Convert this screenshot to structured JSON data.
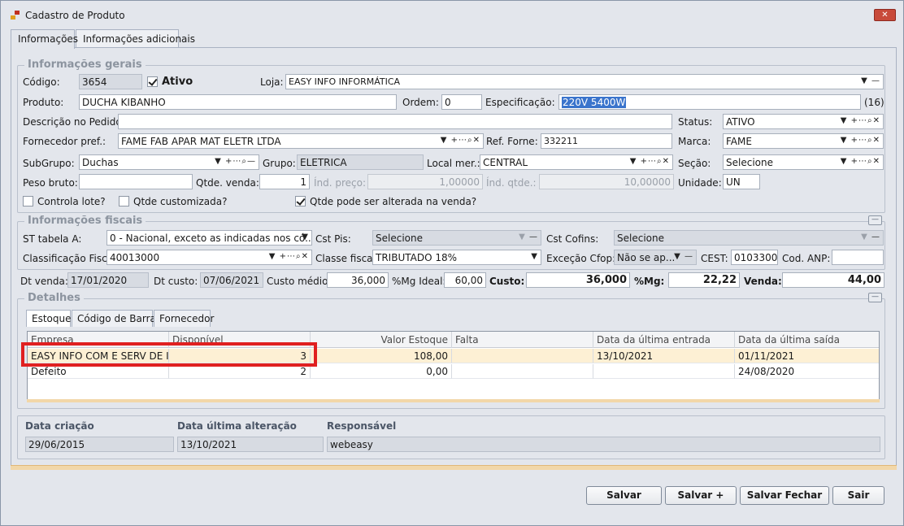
{
  "window": {
    "title": "Cadastro de Produto",
    "close": "✕"
  },
  "tabs": [
    {
      "label": "Informações"
    },
    {
      "label": "Informações adicionais"
    }
  ],
  "gerais": {
    "title": "Informações gerais",
    "codigo_label": "Código:",
    "codigo": "3654",
    "ativo_label": "Ativo",
    "ativo_checked": true,
    "loja_label": "Loja:",
    "loja": "EASY INFO INFORMÁTICA",
    "produto_label": "Produto:",
    "produto": "DUCHA KIBANHO",
    "ordem_label": "Ordem:",
    "ordem": "0",
    "especificacao_label": "Especificação:",
    "especificacao": "220V 5400W",
    "especificacao_count": "(16)",
    "descricao_label": "Descrição no Pedido:",
    "descricao": "",
    "status_label": "Status:",
    "status": "ATIVO",
    "fornecedor_label": "Fornecedor pref.:",
    "fornecedor": "FAME FAB APAR MAT ELETR LTDA",
    "ref_label": "Ref. Forne:",
    "ref": "332211",
    "marca_label": "Marca:",
    "marca": "FAME",
    "subgrupo_label": "SubGrupo:",
    "subgrupo": "Duchas",
    "grupo_label": "Grupo:",
    "grupo": "ELETRICA",
    "local_label": "Local mer.:",
    "local": "CENTRAL",
    "secao_label": "Seção:",
    "secao": "Selecione",
    "peso_label": "Peso bruto:",
    "peso": "",
    "qtde_venda_label": "Qtde. venda:",
    "qtde_venda": "1",
    "ind_preco_label": "Índ. preço:",
    "ind_preco": "1,00000",
    "ind_qtde_label": "Índ. qtde.:",
    "ind_qtde": "10,00000",
    "unidade_label": "Unidade:",
    "unidade": "UN",
    "controla_lote_label": "Controla lote?",
    "qtde_customizada_label": "Qtde customizada?",
    "qtde_alterada_label": "Qtde pode ser alterada na venda?"
  },
  "fiscais": {
    "title": "Informações fiscais",
    "st_label": "ST tabela A:",
    "st": "0 - Nacional, exceto as indicadas nos có...",
    "cstpis_label": "Cst Pis:",
    "cstpis": "Selecione",
    "cstcofins_label": "Cst Cofins:",
    "cstcofins": "Selecione",
    "classfiscal_label": "Classificação Fiscal:",
    "classfiscal": "40013000",
    "classe_label": "Classe fiscal:",
    "classe": "TRIBUTADO 18%",
    "excecao_label": "Exceção Cfop:",
    "excecao": "Não se ap...",
    "cest_label": "CEST:",
    "cest": "0103300",
    "anp_label": "Cod. ANP:",
    "anp": ""
  },
  "valores": {
    "dtvenda_label": "Dt venda:",
    "dtvenda": "17/01/2020",
    "dtcusto_label": "Dt custo:",
    "dtcusto": "07/06/2021",
    "customedio_label": "Custo médio:",
    "customedio": "36,000",
    "mgideal_label": "%Mg Ideal:",
    "mgideal": "60,00",
    "custo_label": "Custo:",
    "custo": "36,000",
    "mg_label": "%Mg:",
    "mg": "22,22",
    "venda_label": "Venda:",
    "venda": "44,00"
  },
  "detalhes": {
    "title": "Detalhes",
    "tabs": [
      {
        "label": "Estoque"
      },
      {
        "label": "Código de Barras"
      },
      {
        "label": "Fornecedor"
      }
    ],
    "columns": [
      "Empresa",
      "Disponível",
      "Valor Estoque",
      "Falta",
      "Data da última entrada",
      "Data da última saída"
    ],
    "rows": [
      [
        "EASY INFO COM E SERV DE INF...",
        "3",
        "108,00",
        "",
        "13/10/2021",
        "01/11/2021"
      ],
      [
        "Defeito",
        "2",
        "0,00",
        "",
        "",
        "24/08/2020"
      ]
    ]
  },
  "auditoria": {
    "criacao_label": "Data criação",
    "criacao": "29/06/2015",
    "alteracao_label": "Data última alteração",
    "alteracao": "13/10/2021",
    "responsavel_label": "Responsável",
    "responsavel": "webeasy"
  },
  "buttons": {
    "salvar": "Salvar",
    "salvar_mais": "Salvar +",
    "salvar_fechar": "Salvar Fechar",
    "sair": "Sair"
  },
  "icons": {
    "dropdown": "▼",
    "add": "+",
    "more": "⋯",
    "search": "⌕",
    "clear": "✕",
    "minus": "—"
  }
}
